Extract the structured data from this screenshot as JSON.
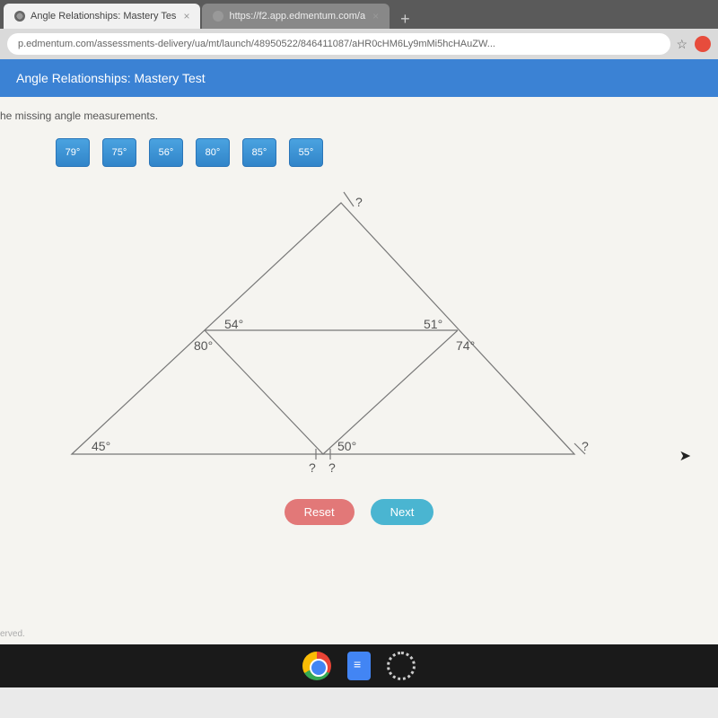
{
  "browser": {
    "tabs": [
      {
        "label": "Angle Relationships: Mastery Tes",
        "active": true
      },
      {
        "label": "https://f2.app.edmentum.com/a",
        "active": false
      }
    ],
    "url": "p.edmentum.com/assessments-delivery/ua/mt/launch/48950522/846411087/aHR0cHM6Ly9mMi5hcHAuZW..."
  },
  "header": {
    "title": "Angle Relationships: Mastery Test"
  },
  "content": {
    "instruction": "he missing angle measurements.",
    "tiles": [
      "79°",
      "75°",
      "56°",
      "80°",
      "85°",
      "55°"
    ],
    "diagram": {
      "angles": {
        "top_unknown": "?",
        "mid_left_outer": "80°",
        "mid_left_inner": "54°",
        "mid_right_inner": "51°",
        "mid_right_outer": "74°",
        "bottom_left": "45°",
        "bottom_mid_right": "50°",
        "bottom_mid_unknown_l": "?",
        "bottom_mid_unknown_r": "?",
        "bottom_right_unknown": "?"
      }
    },
    "buttons": {
      "reset": "Reset",
      "next": "Next"
    },
    "footer": "erved."
  }
}
